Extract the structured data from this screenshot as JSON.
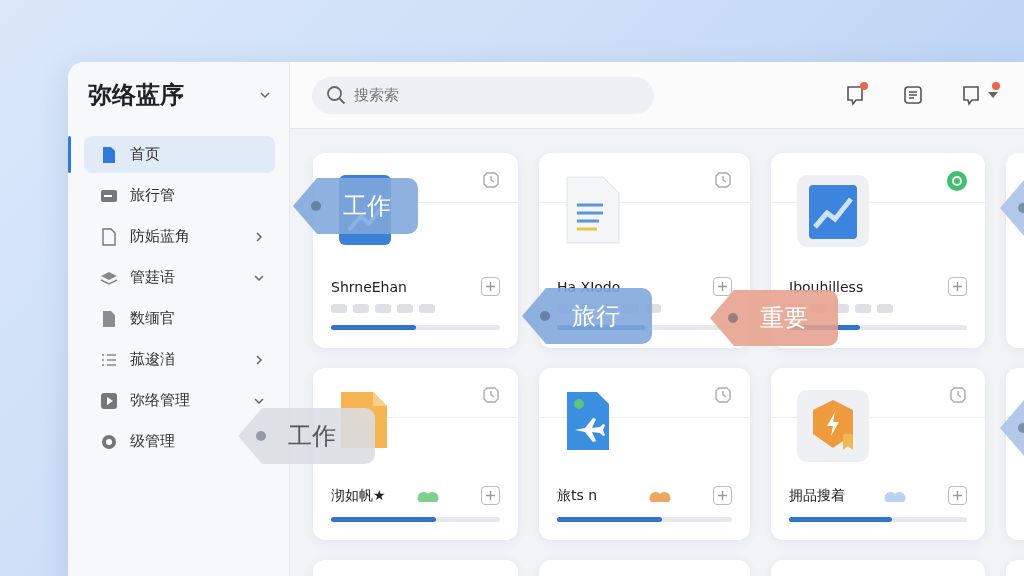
{
  "sidebar": {
    "title": "弥络蓝序",
    "items": [
      {
        "label": "首页",
        "selected": true,
        "kind": "leaf"
      },
      {
        "label": "旅行管",
        "selected": false,
        "kind": "leaf"
      },
      {
        "label": "防姤蓝角",
        "selected": false,
        "kind": "group",
        "expanded": false
      },
      {
        "label": "管莛语",
        "selected": false,
        "kind": "group",
        "expanded": true
      },
      {
        "label": "数缅官",
        "selected": false,
        "kind": "leaf"
      },
      {
        "label": "菰逡渞",
        "selected": false,
        "kind": "group",
        "expanded": false
      },
      {
        "label": "弥络管理",
        "selected": false,
        "kind": "group",
        "expanded": true
      },
      {
        "label": "级管理",
        "selected": false,
        "kind": "leaf"
      }
    ]
  },
  "header": {
    "search": {
      "placeholder": "搜索索"
    },
    "actions": [
      {
        "badge": true
      },
      {
        "badge": false
      },
      {
        "badge": true
      }
    ]
  },
  "cards": [
    {
      "title": "ShrneEhan",
      "level": 0.5
    },
    {
      "title": "Ha XIodo",
      "level": 0.5
    },
    {
      "title": "Ibouhilless",
      "level": 0.4
    },
    {
      "title": "沏如帆★",
      "color": "#7fd08e",
      "level": 0.62
    },
    {
      "title": "旅ts n",
      "color": "#f0a560",
      "level": 0.6
    },
    {
      "title": "拥品搜着",
      "color": "#b9d3f3",
      "level": 0.58
    }
  ],
  "tags": [
    {
      "label": "工作",
      "color": "#7fa6db"
    },
    {
      "label": "旅行",
      "color": "#7fa6db"
    },
    {
      "label": "重要",
      "color": "#e7a08c"
    },
    {
      "label": "工作",
      "color": "#d9dde3"
    },
    {
      "color": "#a9c1e6"
    },
    {
      "color": "#a9c1e6"
    }
  ]
}
